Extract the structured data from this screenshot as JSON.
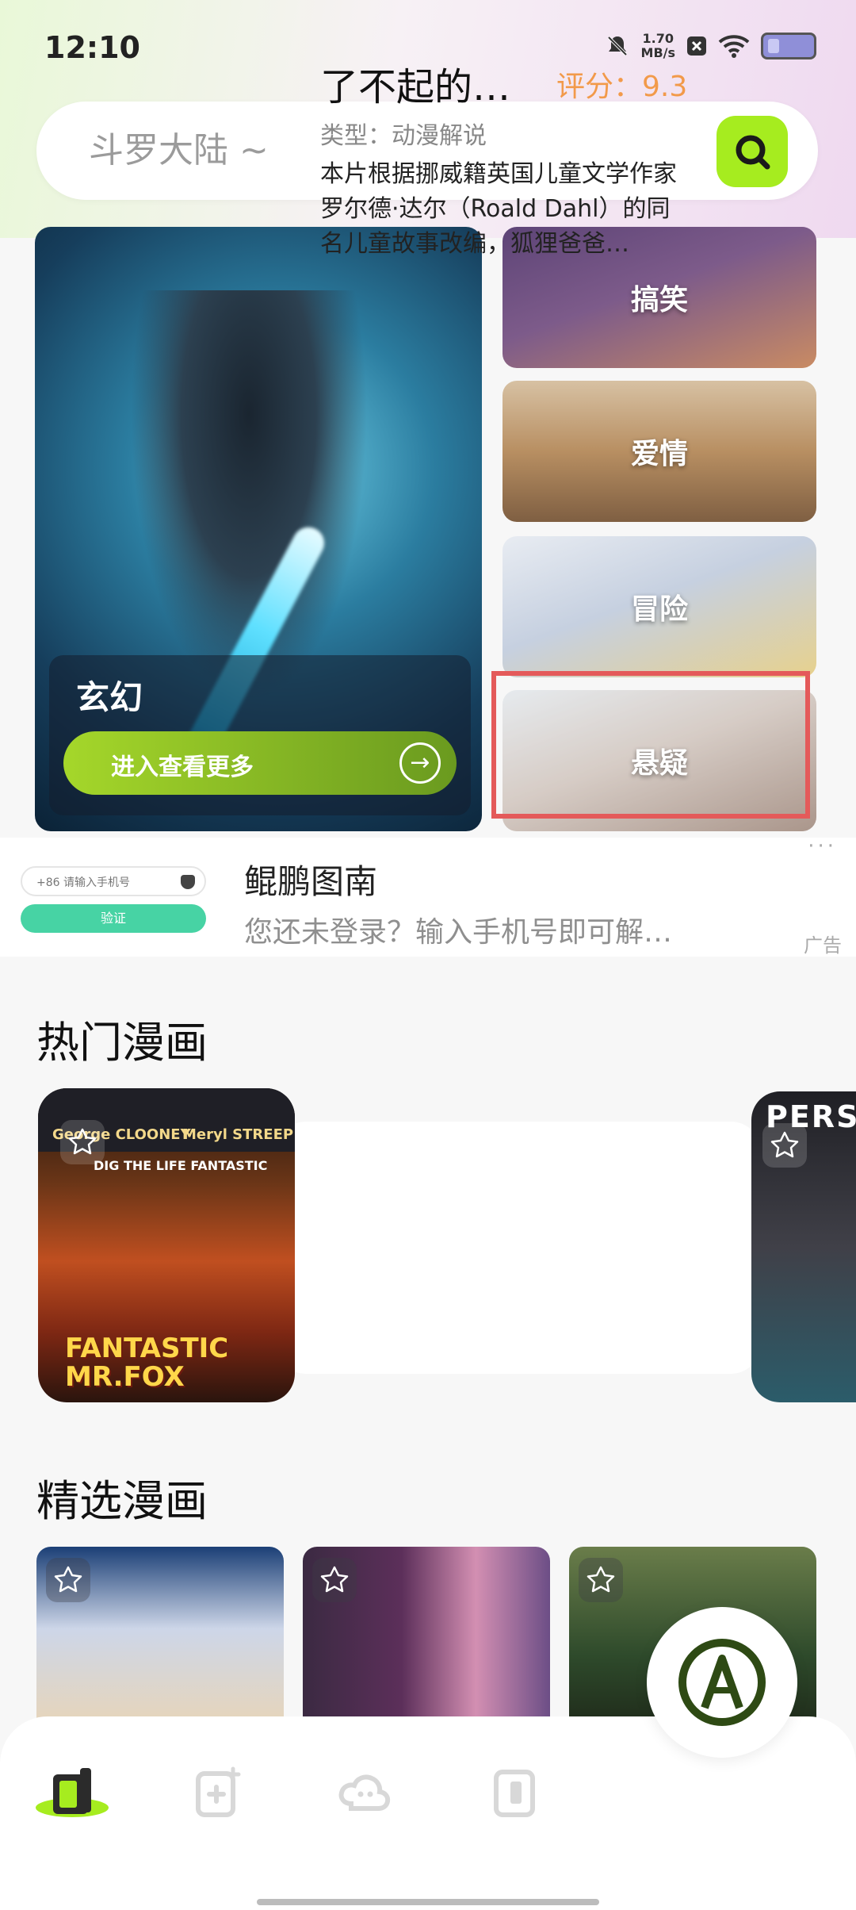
{
  "status_bar": {
    "time": "12:10",
    "net_speed_value": "1.70",
    "net_speed_unit": "MB/s",
    "icons": [
      "bell-mute-icon",
      "close-box-icon",
      "wifi-icon",
      "battery-icon"
    ]
  },
  "search": {
    "placeholder": "斗罗大陆 ~",
    "accent": "#a6ec1f"
  },
  "feature": {
    "title": "玄幻",
    "button": "进入查看更多"
  },
  "categories": [
    {
      "label": "搞笑"
    },
    {
      "label": "爱情"
    },
    {
      "label": "冒险"
    },
    {
      "label": "悬疑"
    }
  ],
  "ad": {
    "phone_placeholder": "+86 请输入手机号",
    "verify_label": "验证",
    "title": "鲲鹏图南",
    "description": "您还未登录？输入手机号即可解…",
    "more": "···",
    "tag": "广告"
  },
  "hot": {
    "section_title": "热门漫画",
    "item": {
      "name": "了不起的…",
      "score": "评分：9.3",
      "type": "类型：动漫解说",
      "description": "本片根据挪威籍英国儿童文学作家罗尔德·达尔（Roald Dahl）的同名儿童故事改编，狐狸爸爸…",
      "cover": {
        "head1": "George CLOONEY",
        "head2": "Meryl STREEP",
        "tag": "DIG THE LIFE FANTASTIC",
        "title": "FANTASTIC MR.FOX"
      }
    },
    "next_cover_text": "PERS"
  },
  "featured": {
    "section_title": "精选漫画",
    "items": [
      {
        "name": ""
      },
      {
        "name": ""
      },
      {
        "name": ""
      }
    ]
  },
  "bottom_nav": {
    "items": [
      "home-icon",
      "add-page-icon",
      "cloud-chat-icon",
      "library-icon"
    ],
    "active_color": "#a6ec1f"
  }
}
